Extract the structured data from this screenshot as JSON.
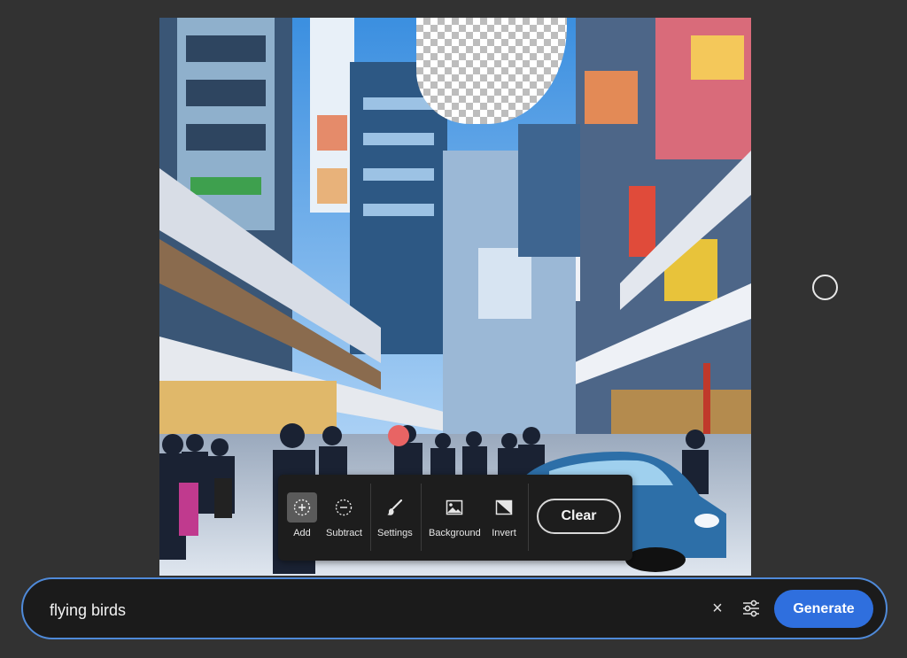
{
  "canvas": {
    "image_description_icon": "city-street-image"
  },
  "toolbar": {
    "tools": [
      {
        "label": "Add",
        "icon": "add-selection-icon",
        "active": true
      },
      {
        "label": "Subtract",
        "icon": "subtract-selection-icon",
        "active": false
      },
      {
        "label": "Settings",
        "icon": "brush-icon",
        "active": false
      },
      {
        "label": "Background",
        "icon": "image-icon",
        "active": false
      },
      {
        "label": "Invert",
        "icon": "invert-icon",
        "active": false
      }
    ],
    "clear_label": "Clear"
  },
  "prompt": {
    "value": "flying birds",
    "clear_icon": "×",
    "generate_label": "Generate"
  },
  "colors": {
    "accent": "#2f6fde",
    "focus_border": "#4f8ad9",
    "toolbar_bg": "#1d1d1d",
    "app_bg": "#323232"
  }
}
